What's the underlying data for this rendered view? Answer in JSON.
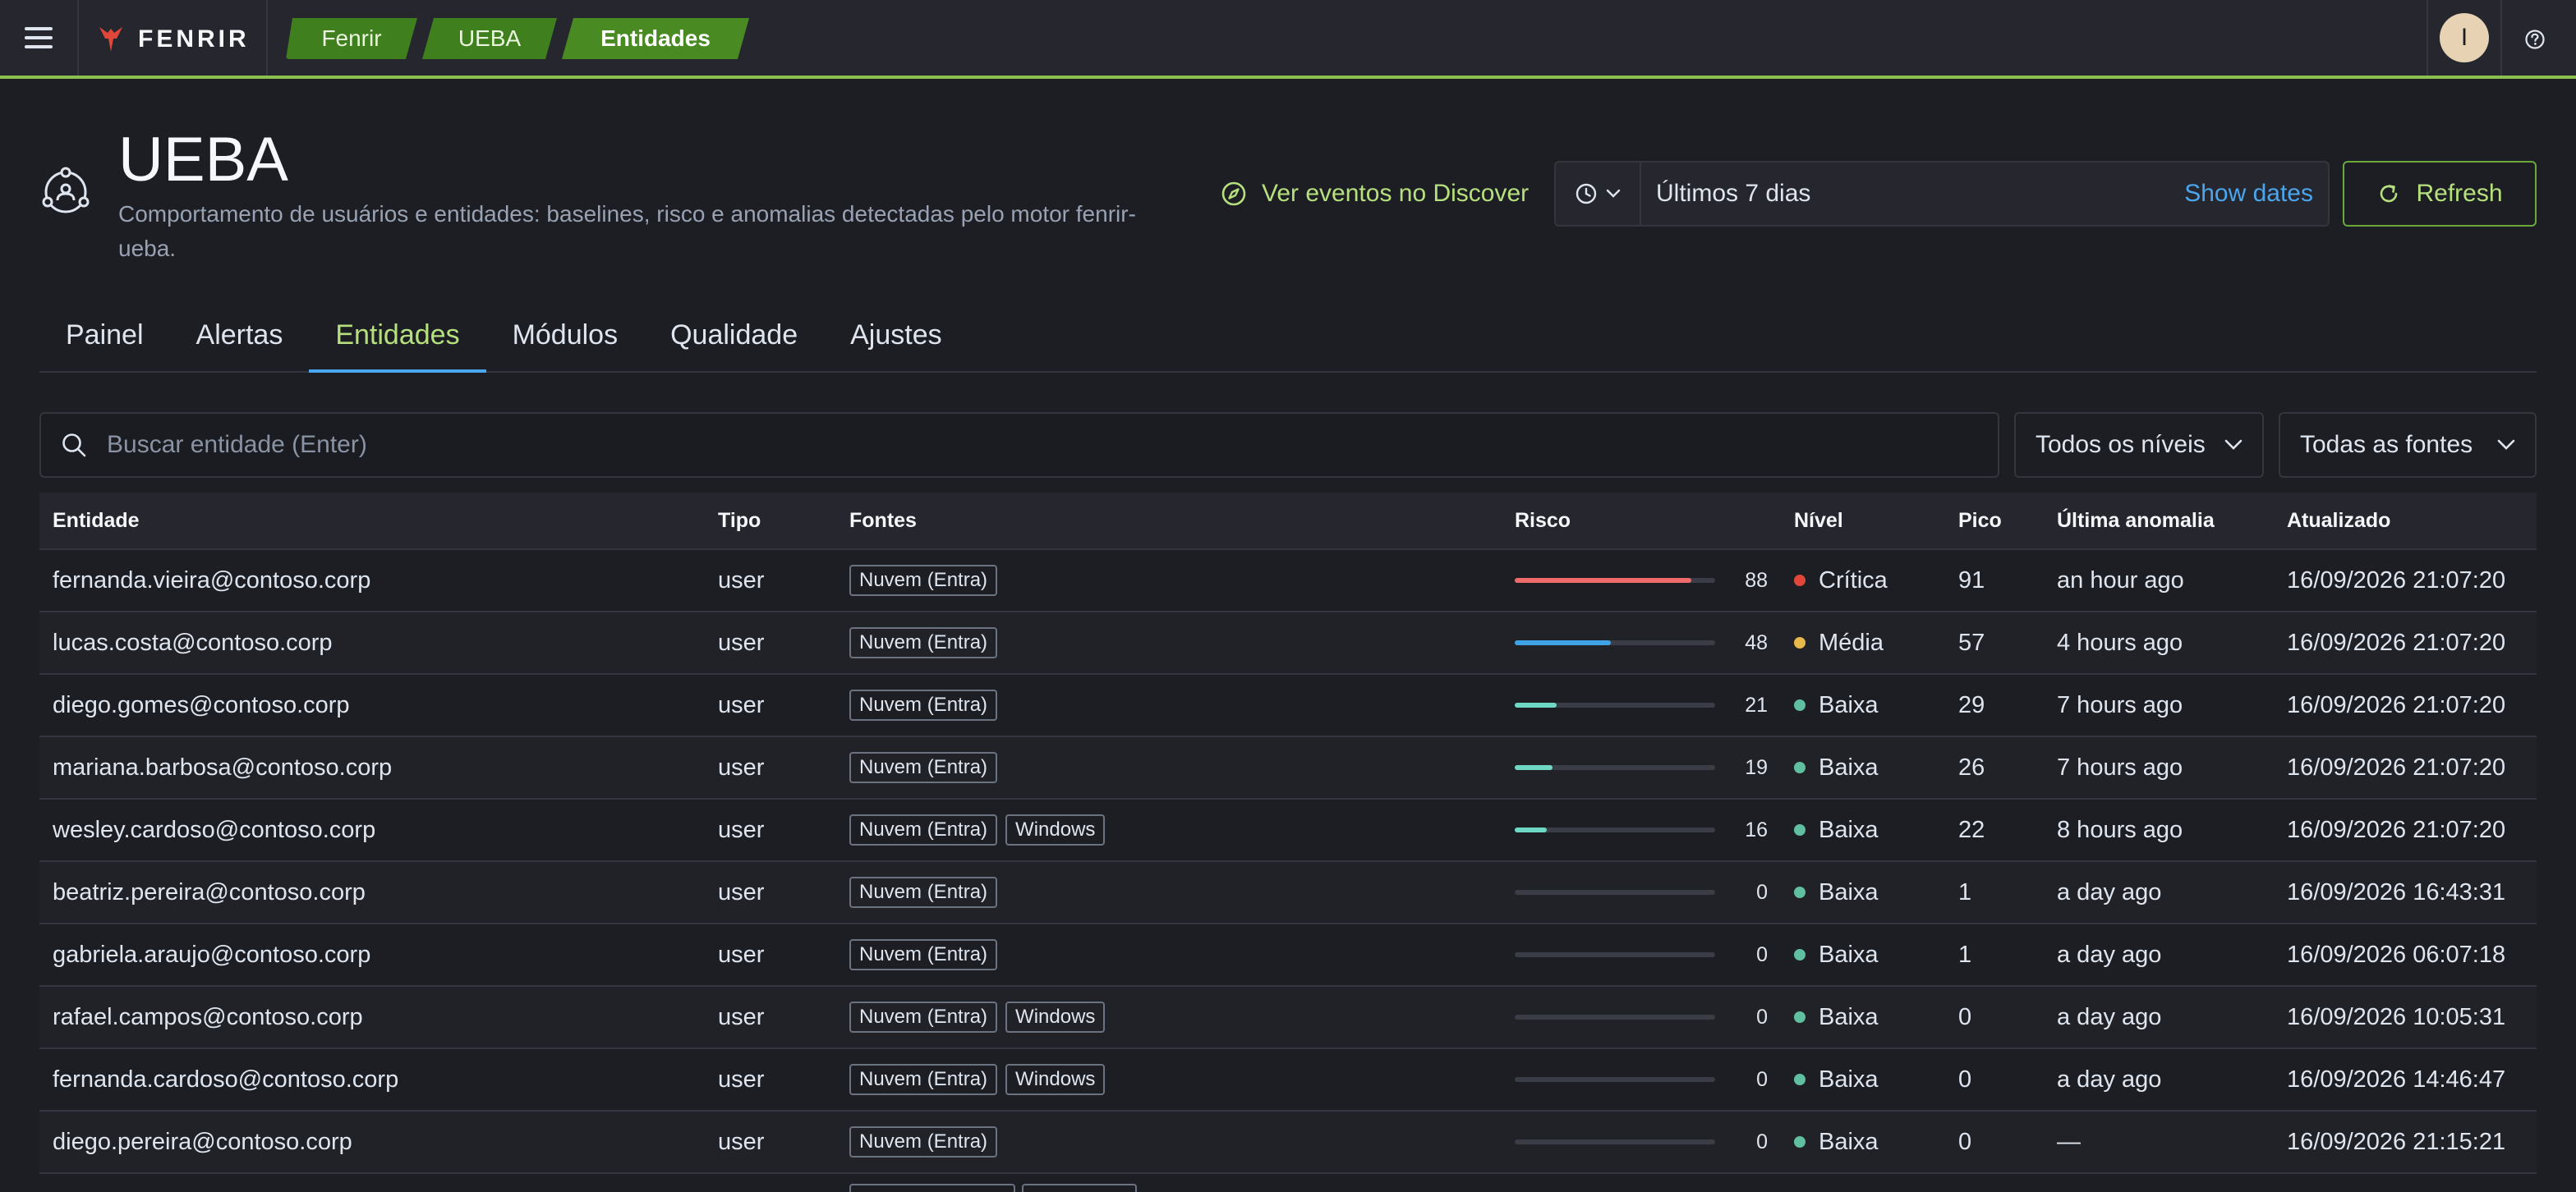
{
  "header": {
    "brand": "FENRIR",
    "breadcrumbs": [
      "Fenrir",
      "UEBA",
      "Entidades"
    ],
    "avatar_initial": "I",
    "accent": "#8cc152"
  },
  "page": {
    "title": "UEBA",
    "description": "Comportamento de usuários e entidades: baselines, risco e anomalias detectadas pelo motor fenrir-ueba.",
    "discover_link": "Ver eventos no Discover",
    "date_range": "Últimos 7 dias",
    "show_dates": "Show dates",
    "refresh": "Refresh"
  },
  "tabs": [
    {
      "label": "Painel",
      "active": false
    },
    {
      "label": "Alertas",
      "active": false
    },
    {
      "label": "Entidades",
      "active": true
    },
    {
      "label": "Módulos",
      "active": false
    },
    {
      "label": "Qualidade",
      "active": false
    },
    {
      "label": "Ajustes",
      "active": false
    }
  ],
  "filters": {
    "search_placeholder": "Buscar entidade (Enter)",
    "levels": "Todos os níveis",
    "sources": "Todas as fontes"
  },
  "table": {
    "columns": [
      "Entidade",
      "Tipo",
      "Fontes",
      "Risco",
      "Nível",
      "Pico",
      "Última anomalia",
      "Atualizado"
    ],
    "level_colors": {
      "Crítica": "#e0473a",
      "Média": "#e8b84a",
      "Baixa": "#5fbf9f"
    },
    "rows": [
      {
        "entity": "fernanda.vieira@contoso.corp",
        "type": "user",
        "sources": [
          "Nuvem (Entra)"
        ],
        "risk": 88,
        "risk_color": "#ef6b6b",
        "level": "Crítica",
        "peak": "91",
        "last_anomaly": "an hour ago",
        "updated": "16/09/2026 21:07:20"
      },
      {
        "entity": "lucas.costa@contoso.corp",
        "type": "user",
        "sources": [
          "Nuvem (Entra)"
        ],
        "risk": 48,
        "risk_color": "#3fa3e6",
        "level": "Média",
        "peak": "57",
        "last_anomaly": "4 hours ago",
        "updated": "16/09/2026 21:07:20"
      },
      {
        "entity": "diego.gomes@contoso.corp",
        "type": "user",
        "sources": [
          "Nuvem (Entra)"
        ],
        "risk": 21,
        "risk_color": "#6ed8c4",
        "level": "Baixa",
        "peak": "29",
        "last_anomaly": "7 hours ago",
        "updated": "16/09/2026 21:07:20"
      },
      {
        "entity": "mariana.barbosa@contoso.corp",
        "type": "user",
        "sources": [
          "Nuvem (Entra)"
        ],
        "risk": 19,
        "risk_color": "#6ed8c4",
        "level": "Baixa",
        "peak": "26",
        "last_anomaly": "7 hours ago",
        "updated": "16/09/2026 21:07:20"
      },
      {
        "entity": "wesley.cardoso@contoso.corp",
        "type": "user",
        "sources": [
          "Nuvem (Entra)",
          "Windows"
        ],
        "risk": 16,
        "risk_color": "#6ed8c4",
        "level": "Baixa",
        "peak": "22",
        "last_anomaly": "8 hours ago",
        "updated": "16/09/2026 21:07:20"
      },
      {
        "entity": "beatriz.pereira@contoso.corp",
        "type": "user",
        "sources": [
          "Nuvem (Entra)"
        ],
        "risk": 0,
        "risk_color": "#6ed8c4",
        "level": "Baixa",
        "peak": "1",
        "last_anomaly": "a day ago",
        "updated": "16/09/2026 16:43:31"
      },
      {
        "entity": "gabriela.araujo@contoso.corp",
        "type": "user",
        "sources": [
          "Nuvem (Entra)"
        ],
        "risk": 0,
        "risk_color": "#6ed8c4",
        "level": "Baixa",
        "peak": "1",
        "last_anomaly": "a day ago",
        "updated": "16/09/2026 06:07:18"
      },
      {
        "entity": "rafael.campos@contoso.corp",
        "type": "user",
        "sources": [
          "Nuvem (Entra)",
          "Windows"
        ],
        "risk": 0,
        "risk_color": "#6ed8c4",
        "level": "Baixa",
        "peak": "0",
        "last_anomaly": "a day ago",
        "updated": "16/09/2026 10:05:31"
      },
      {
        "entity": "fernanda.cardoso@contoso.corp",
        "type": "user",
        "sources": [
          "Nuvem (Entra)",
          "Windows"
        ],
        "risk": 0,
        "risk_color": "#6ed8c4",
        "level": "Baixa",
        "peak": "0",
        "last_anomaly": "a day ago",
        "updated": "16/09/2026 14:46:47"
      },
      {
        "entity": "diego.pereira@contoso.corp",
        "type": "user",
        "sources": [
          "Nuvem (Entra)"
        ],
        "risk": 0,
        "risk_color": "#6ed8c4",
        "level": "Baixa",
        "peak": "0",
        "last_anomaly": "—",
        "updated": "16/09/2026 21:15:21"
      }
    ]
  },
  "icons": {
    "menu": "hamburger-icon",
    "logo": "wolf-logo-icon",
    "help": "help-icon",
    "page": "entity-network-icon",
    "discover": "compass-icon",
    "clock": "clock-icon",
    "refresh": "refresh-icon",
    "search": "search-icon",
    "chevron": "chevron-down-icon"
  }
}
